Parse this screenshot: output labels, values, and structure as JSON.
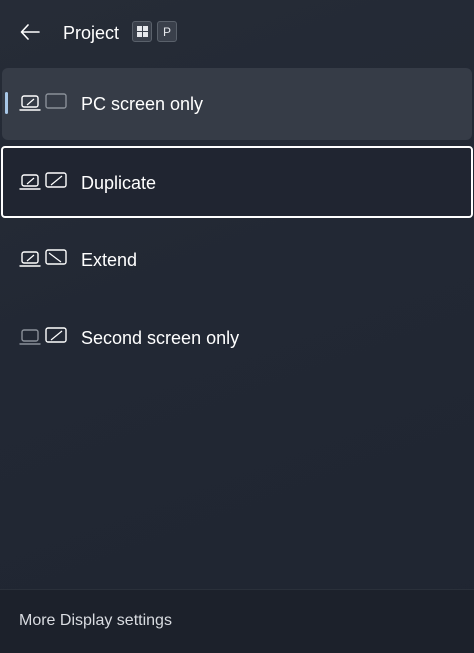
{
  "header": {
    "title": "Project",
    "shortcut_keys": [
      "⊞",
      "P"
    ]
  },
  "options": [
    {
      "label": "PC screen only",
      "icon": "pc-screen-only-icon",
      "state": "active"
    },
    {
      "label": "Duplicate",
      "icon": "duplicate-icon",
      "state": "focused"
    },
    {
      "label": "Extend",
      "icon": "extend-icon",
      "state": "normal"
    },
    {
      "label": "Second screen only",
      "icon": "second-screen-only-icon",
      "state": "normal"
    }
  ],
  "footer": {
    "link_label": "More Display settings"
  },
  "colors": {
    "background": "#222834",
    "active_item": "#363c47",
    "indicator": "#a9c8e8",
    "focus_border": "#ffffff"
  }
}
